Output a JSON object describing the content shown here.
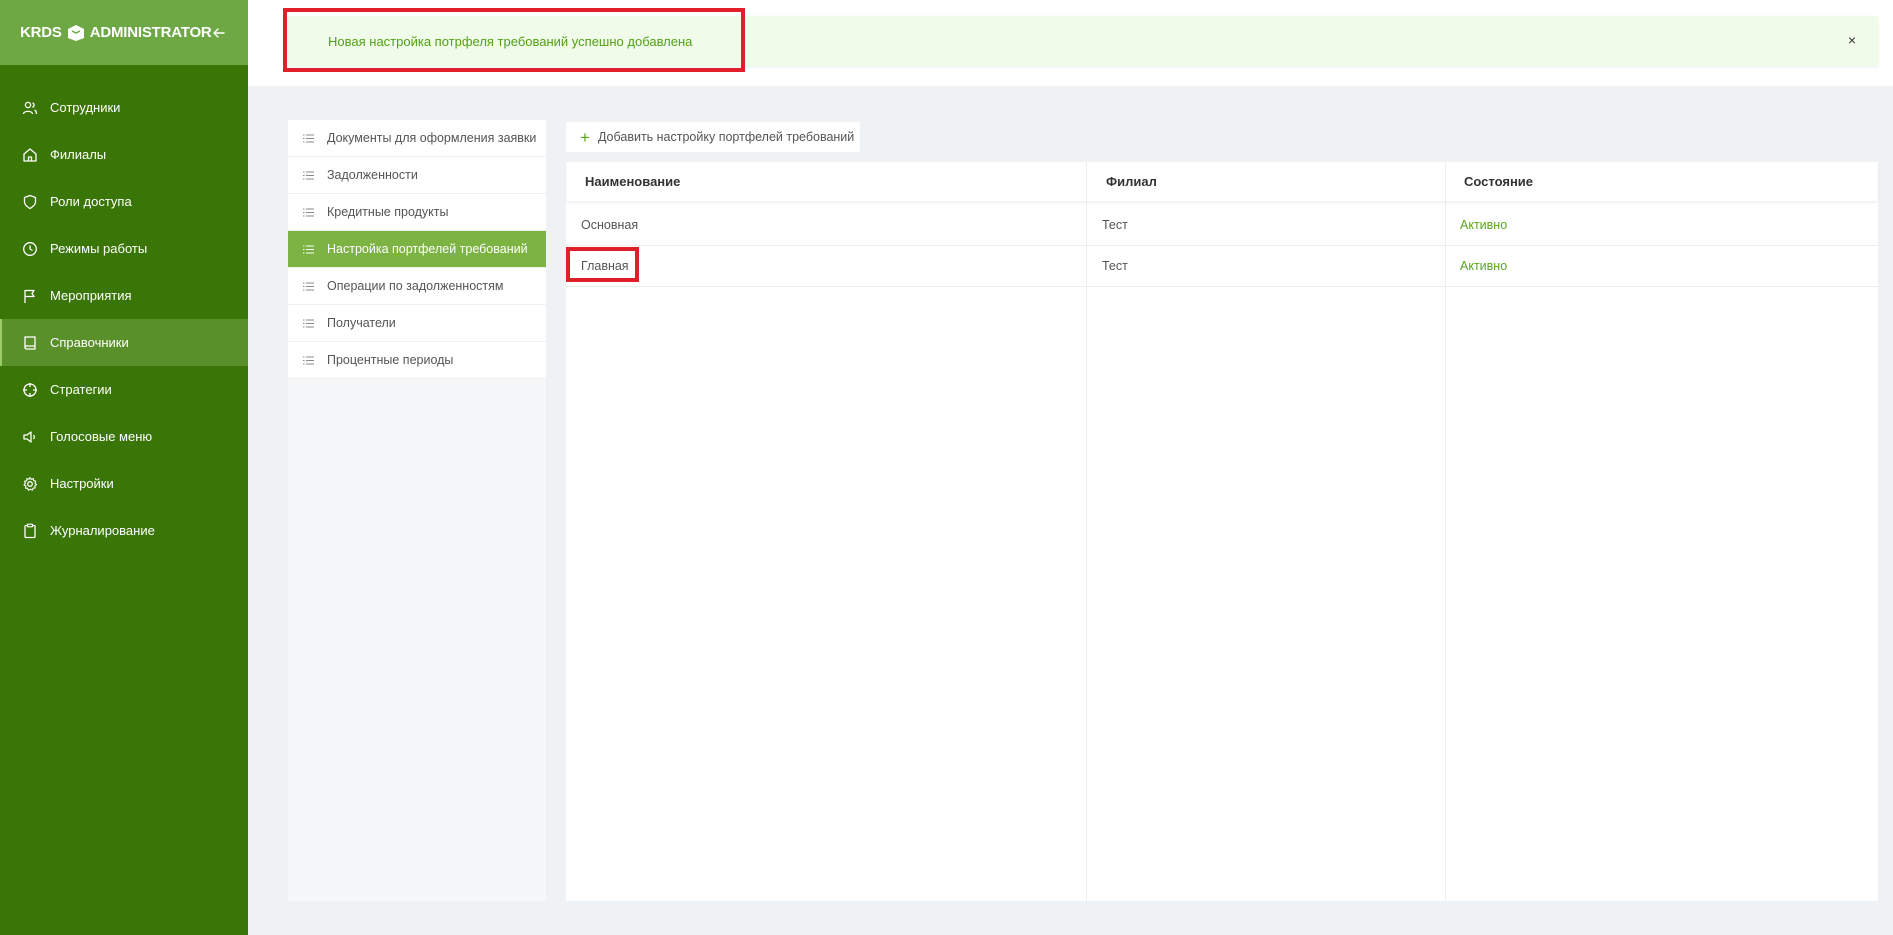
{
  "app": {
    "logo_left": "KRDS",
    "logo_right": "ADMINISTRATOR"
  },
  "sidebar": {
    "items": [
      {
        "label": "Сотрудники",
        "icon": "users-icon"
      },
      {
        "label": "Филиалы",
        "icon": "home-icon"
      },
      {
        "label": "Роли доступа",
        "icon": "shield-icon"
      },
      {
        "label": "Режимы работы",
        "icon": "clock-icon"
      },
      {
        "label": "Мероприятия",
        "icon": "flag-icon"
      },
      {
        "label": "Справочники",
        "icon": "book-icon",
        "active": true
      },
      {
        "label": "Стратегии",
        "icon": "crosshair-icon"
      },
      {
        "label": "Голосовые меню",
        "icon": "speaker-icon"
      },
      {
        "label": "Настройки",
        "icon": "gear-icon"
      },
      {
        "label": "Журналирование",
        "icon": "clipboard-icon"
      }
    ]
  },
  "alert": {
    "message": "Новая настройка потрфеля требований успешно добавлена",
    "close": "×"
  },
  "submenu": {
    "items": [
      {
        "label": "Документы для оформления заявки"
      },
      {
        "label": "Задолженности"
      },
      {
        "label": "Кредитные продукты"
      },
      {
        "label": "Настройка портфелей требований",
        "active": true
      },
      {
        "label": "Операции по задолженностям"
      },
      {
        "label": "Получатели"
      },
      {
        "label": "Процентные периоды"
      }
    ]
  },
  "toolbar": {
    "add_label": "Добавить настройку портфелей требований"
  },
  "table": {
    "headers": [
      "Наименование",
      "Филиал",
      "Состояние"
    ],
    "rows": [
      {
        "name": "Основная",
        "branch": "Тест",
        "status": "Активно"
      },
      {
        "name": "Главная",
        "branch": "Тест",
        "status": "Активно"
      }
    ]
  },
  "colors": {
    "sidebar": "#3a7508",
    "sidebar_header": "#6ea844",
    "accent": "#5aa71a",
    "submenu_active": "#7cb342",
    "highlight": "#e01f2a"
  }
}
